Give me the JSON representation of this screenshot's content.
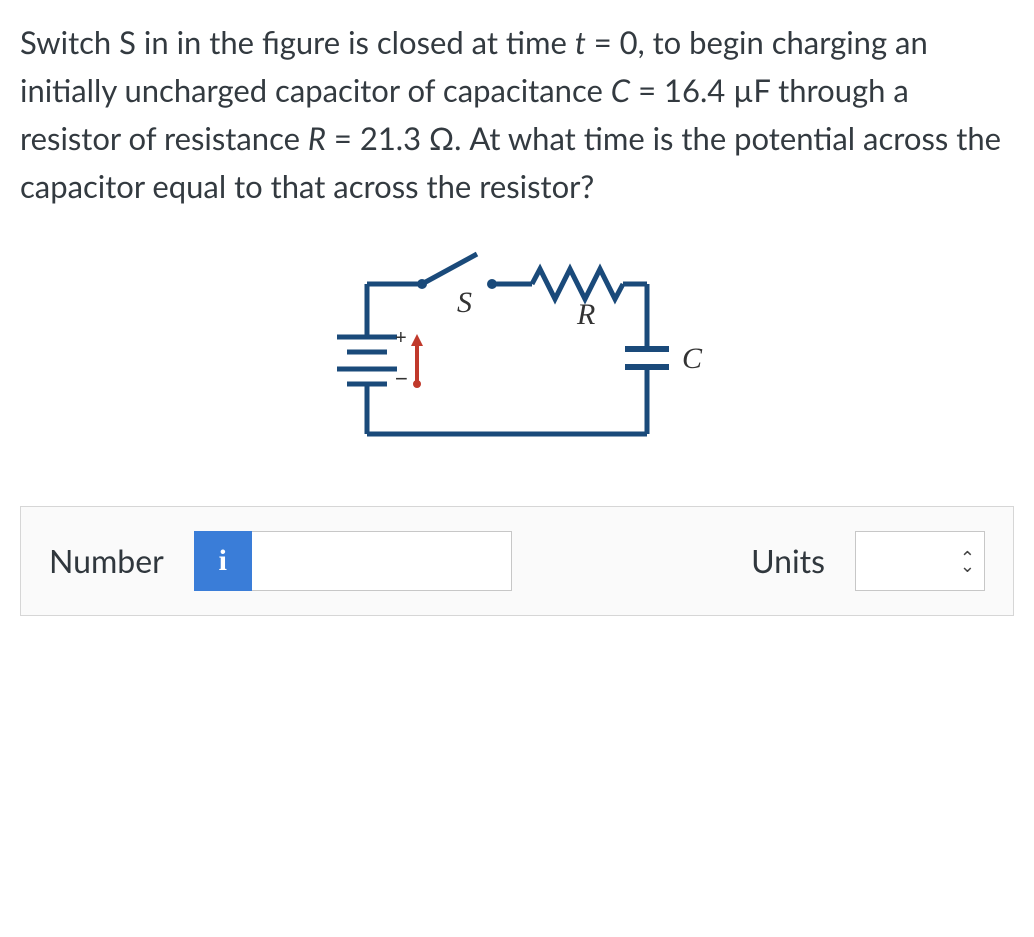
{
  "question": {
    "p1a": "Switch S in in the figure is closed at time ",
    "t_var": "t",
    "p1b": " = 0, to begin charging an initially uncharged capacitor of capacitance ",
    "c_var": "C",
    "p1c": " = 16.4 µF through a resistor of resistance ",
    "r_var": "R",
    "p1d": " = 21.3 Ω. At what time is the potential across the capacitor equal to that across the resistor?"
  },
  "diagram": {
    "labels": {
      "S": "S",
      "R": "R",
      "C": "C",
      "plus": "+",
      "minus": "−",
      "emf": "↓"
    }
  },
  "answer": {
    "number_label": "Number",
    "info_icon": "i",
    "number_value": "",
    "units_label": "Units",
    "units_value": ""
  }
}
